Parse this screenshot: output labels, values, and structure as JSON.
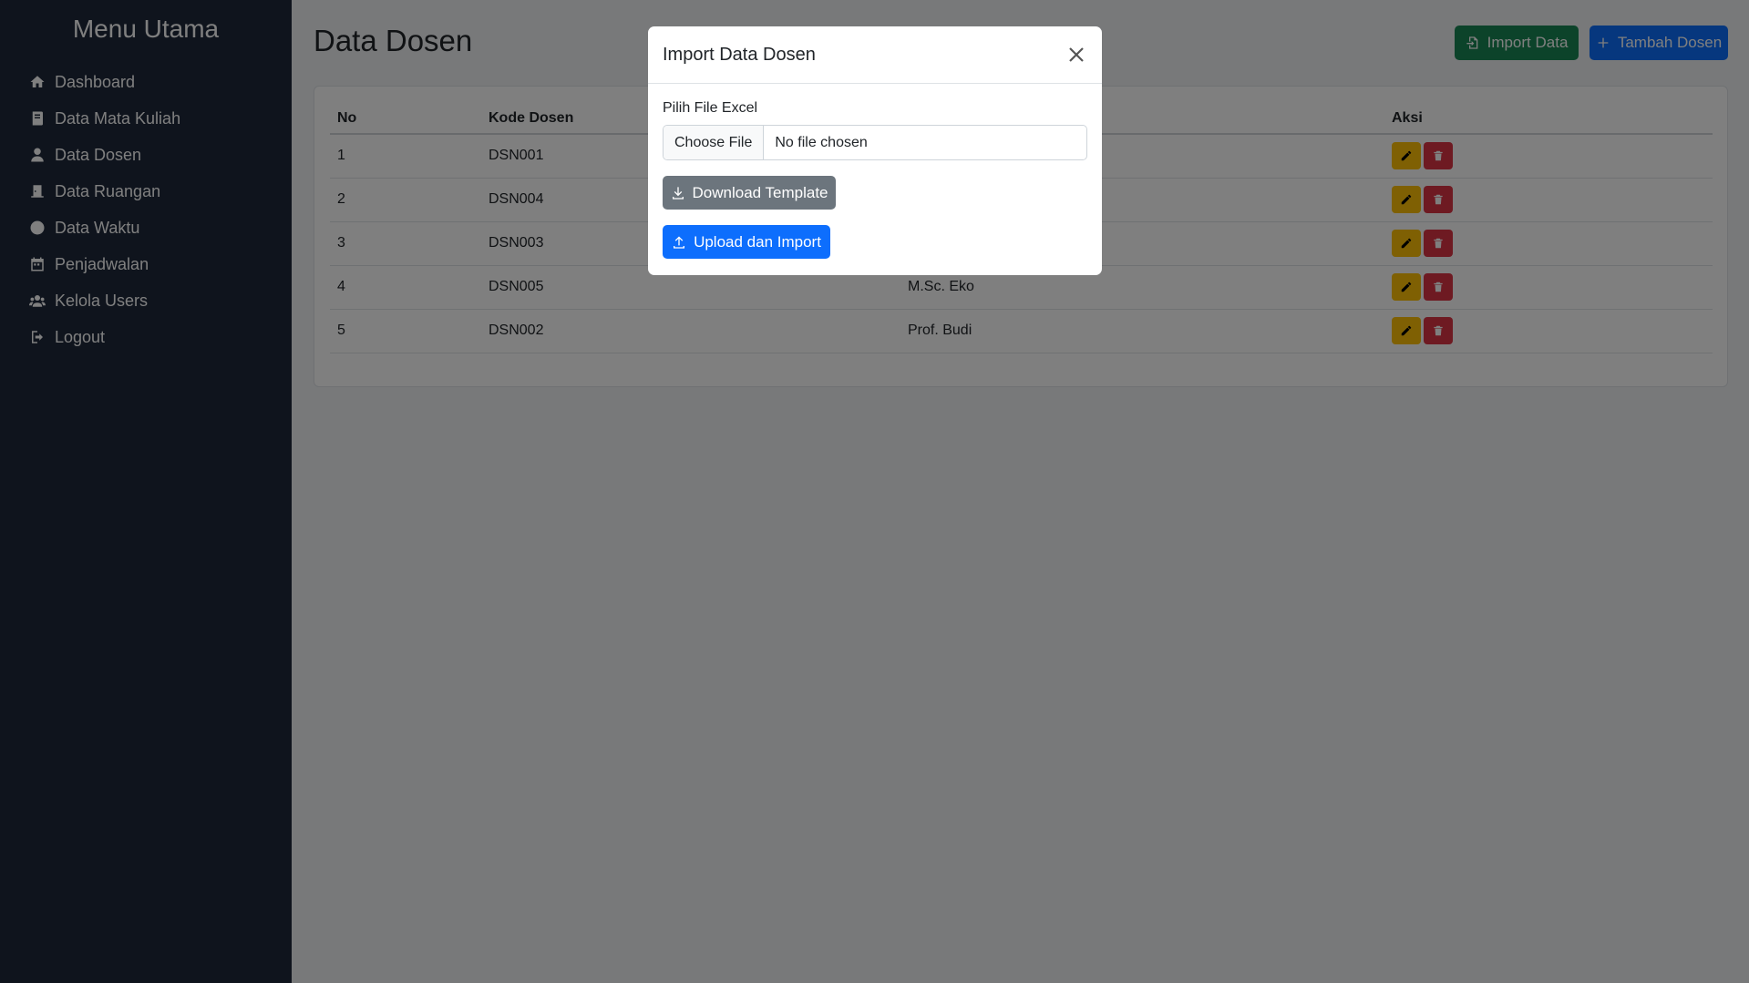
{
  "sidebar": {
    "title": "Menu Utama",
    "items": [
      {
        "label": "Dashboard",
        "icon": "home-icon"
      },
      {
        "label": "Data Mata Kuliah",
        "icon": "book-icon"
      },
      {
        "label": "Data Dosen",
        "icon": "user-icon"
      },
      {
        "label": "Data Ruangan",
        "icon": "door-icon"
      },
      {
        "label": "Data Waktu",
        "icon": "clock-icon"
      },
      {
        "label": "Penjadwalan",
        "icon": "calendar-icon"
      },
      {
        "label": "Kelola Users",
        "icon": "users-icon"
      },
      {
        "label": "Logout",
        "icon": "logout-icon"
      }
    ]
  },
  "main": {
    "title": "Data Dosen",
    "import_label": "Import Data",
    "add_label": "Tambah Dosen"
  },
  "table": {
    "headers": {
      "no": "No",
      "kode": "Kode Dosen",
      "nama": "",
      "aksi": "Aksi"
    },
    "rows": [
      {
        "no": "1",
        "kode": "DSN001",
        "nama": ""
      },
      {
        "no": "2",
        "kode": "DSN004",
        "nama": ""
      },
      {
        "no": "3",
        "kode": "DSN003",
        "nama": ""
      },
      {
        "no": "4",
        "kode": "DSN005",
        "nama": "M.Sc. Eko"
      },
      {
        "no": "5",
        "kode": "DSN002",
        "nama": "Prof. Budi"
      }
    ]
  },
  "modal": {
    "title": "Import Data Dosen",
    "file_label": "Pilih File Excel",
    "choose_file": "Choose File",
    "no_file": "No file chosen",
    "download_label": "Download Template",
    "upload_label": "Upload dan Import"
  },
  "colors": {
    "sidebar_bg": "#1e293b",
    "primary": "#0d6efd",
    "success": "#198754",
    "secondary": "#6c757d",
    "warning": "#ffc107",
    "danger": "#dc3545"
  }
}
